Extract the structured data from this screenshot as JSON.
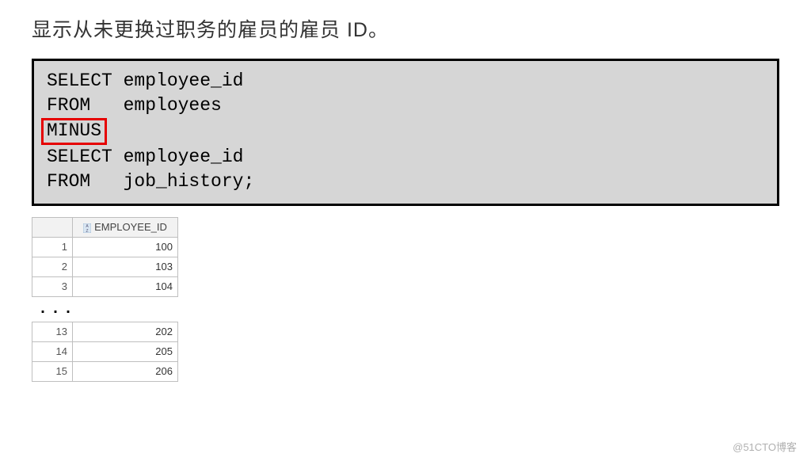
{
  "title": "显示从未更换过职务的雇员的雇员 ID。",
  "sql": {
    "lines": [
      "SELECT employee_id",
      "FROM   employees",
      "MINUS",
      "SELECT employee_id",
      "FROM   job_history;"
    ],
    "highlight_keyword": "MINUS"
  },
  "result": {
    "column_header": "EMPLOYEE_ID",
    "rows_top": [
      {
        "n": "1",
        "v": "100"
      },
      {
        "n": "2",
        "v": "103"
      },
      {
        "n": "3",
        "v": "104"
      }
    ],
    "ellipsis": "...",
    "rows_bottom": [
      {
        "n": "13",
        "v": "202"
      },
      {
        "n": "14",
        "v": "205"
      },
      {
        "n": "15",
        "v": "206"
      }
    ]
  },
  "watermark": "@51CTO博客"
}
